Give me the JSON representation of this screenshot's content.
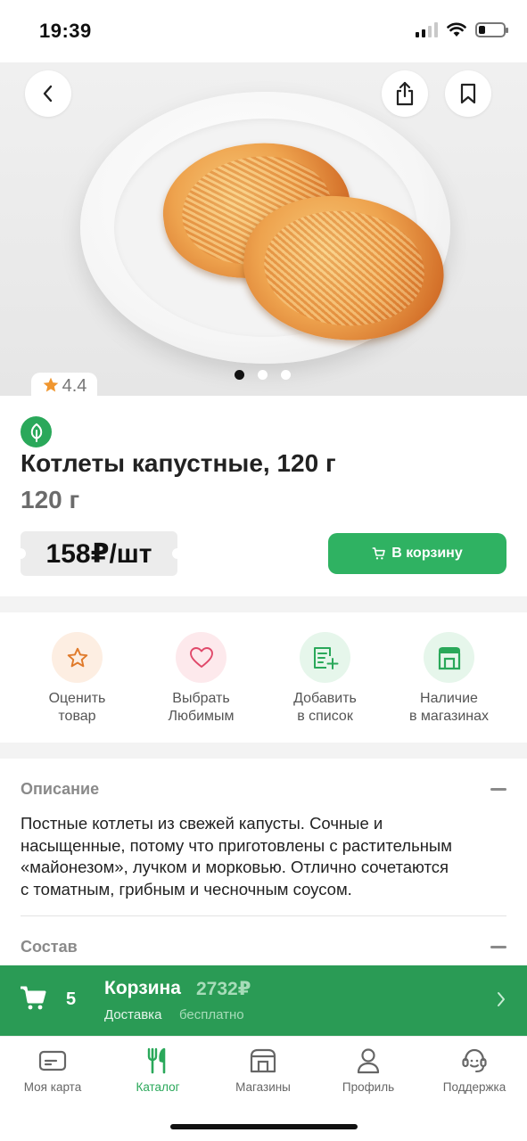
{
  "status_bar": {
    "time": "19:39",
    "signal_bars": 2,
    "battery_level": 0.25
  },
  "hero": {
    "image_alt": "Котлеты капустные на тарелке",
    "page_count": 3,
    "active_page": 1
  },
  "rating": {
    "value": "4.4"
  },
  "product": {
    "title": "Котлеты капустные, 120 г",
    "weight": "120 г",
    "price": "158₽/шт",
    "cart_button_label": "В корзину",
    "badge_icon": "leaf-icon"
  },
  "actions": [
    {
      "icon": "star-icon",
      "line1": "Оценить",
      "line2": "товар"
    },
    {
      "icon": "heart-icon",
      "line1": "Выбрать",
      "line2": "Любимым"
    },
    {
      "icon": "add-to-list-icon",
      "line1": "Добавить",
      "line2": "в список"
    },
    {
      "icon": "store-icon",
      "line1": "Наличие",
      "line2": "в магазинах"
    }
  ],
  "sections": {
    "description_title": "Описание",
    "description_lines": [
      "Постные котлеты из свежей капусты. Сочные и",
      "насыщенные, потому что приготовлены с растительным",
      "«майонезом», лучком и морковью. Отлично сочетаются",
      "с томатным, грибным и чесночным соусом."
    ],
    "composition_title": "Состав"
  },
  "cart_bar": {
    "count": "5",
    "title": "Корзина",
    "total": "2732₽",
    "delivery_label": "Доставка",
    "delivery_value": "бесплатно"
  },
  "tab_bar": [
    {
      "icon": "card-icon",
      "label": "Моя карта",
      "active": false
    },
    {
      "icon": "fork-knife-icon",
      "label": "Каталог",
      "active": true
    },
    {
      "icon": "store-icon",
      "label": "Магазины",
      "active": false
    },
    {
      "icon": "profile-icon",
      "label": "Профиль",
      "active": false
    },
    {
      "icon": "support-icon",
      "label": "Поддержка",
      "active": false
    }
  ],
  "colors": {
    "brand_green": "#2fb262",
    "cart_bar_green": "#2a9b55",
    "rating_star": "#f0962f",
    "muted_text": "#8a8a8a"
  }
}
